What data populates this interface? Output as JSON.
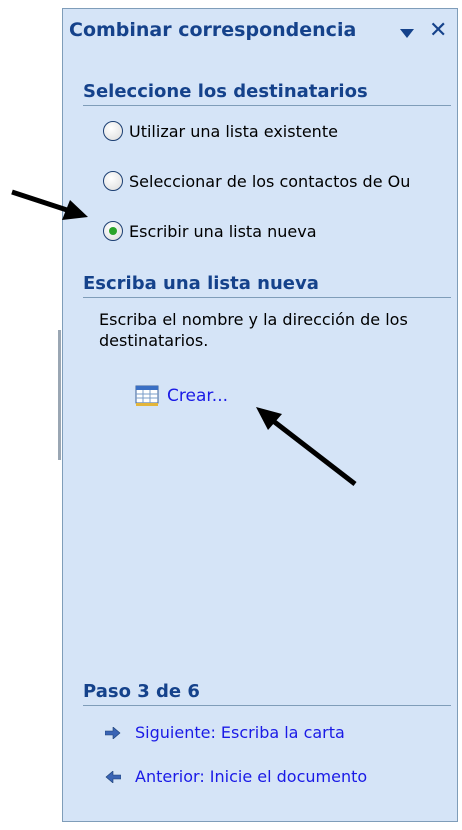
{
  "panel": {
    "title": "Combinar correspondencia",
    "dropdown_icon": "dropdown-arrow-icon",
    "close_label": "✕",
    "close_icon": "close-icon"
  },
  "select_recipients": {
    "heading": "Seleccione los destinatarios",
    "options": [
      {
        "label": "Utilizar una lista existente",
        "checked": false
      },
      {
        "label": "Seleccionar de los contactos de Ou",
        "checked": false
      },
      {
        "label": "Escribir una lista nueva",
        "checked": true
      }
    ]
  },
  "new_list": {
    "heading": "Escriba una lista nueva",
    "description": "Escriba el nombre y la dirección de los destinatarios.",
    "create_label": "Crear...",
    "create_icon": "table-icon"
  },
  "step": {
    "heading": "Paso 3 de 6",
    "next_label": "Siguiente: Escriba la carta",
    "next_icon": "arrow-right-icon",
    "prev_label": "Anterior: Inicie el documento",
    "prev_icon": "arrow-left-icon"
  },
  "colors": {
    "panel_bg": "#d5e4f7",
    "heading_text": "#15428b",
    "link_text": "#1a1ae6",
    "radio_checked": "#2aa42a"
  }
}
